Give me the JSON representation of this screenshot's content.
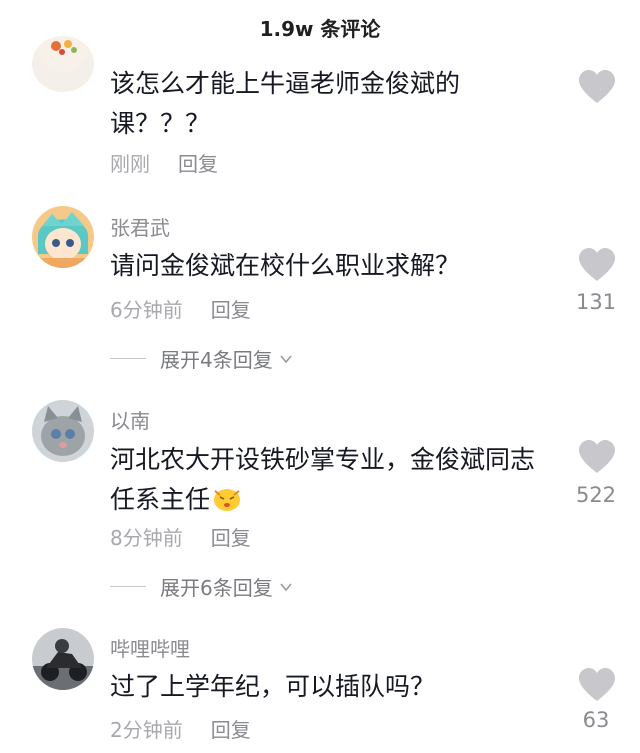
{
  "header": {
    "title": "1.9w 条评论"
  },
  "comments": [
    {
      "username": "",
      "text": "该怎么才能上牛逼老师金俊斌的课？？？",
      "time": "刚刚",
      "reply": "回复",
      "likes": "",
      "expand": ""
    },
    {
      "username": "张君武",
      "text": "请问金俊斌在校什么职业求解？",
      "time": "6分钟前",
      "reply": "回复",
      "likes": "131",
      "expand": "展开4条回复"
    },
    {
      "username": "以南",
      "text": "河北农大开设铁砂掌专业，金俊斌同志任系主任",
      "time": "8分钟前",
      "reply": "回复",
      "likes": "522",
      "expand": "展开6条回复"
    },
    {
      "username": "哔哩哔哩",
      "text": "过了上学年纪，可以插队吗？",
      "time": "2分钟前",
      "reply": "回复",
      "likes": "63",
      "expand": ""
    }
  ],
  "icons": {
    "like": "heart-icon",
    "expand": "chevron-down-icon",
    "emoji": "face-emoji-icon"
  },
  "colors": {
    "text": "#161823",
    "secondary": "#8a8b91",
    "heart": "#c7c7cc"
  }
}
